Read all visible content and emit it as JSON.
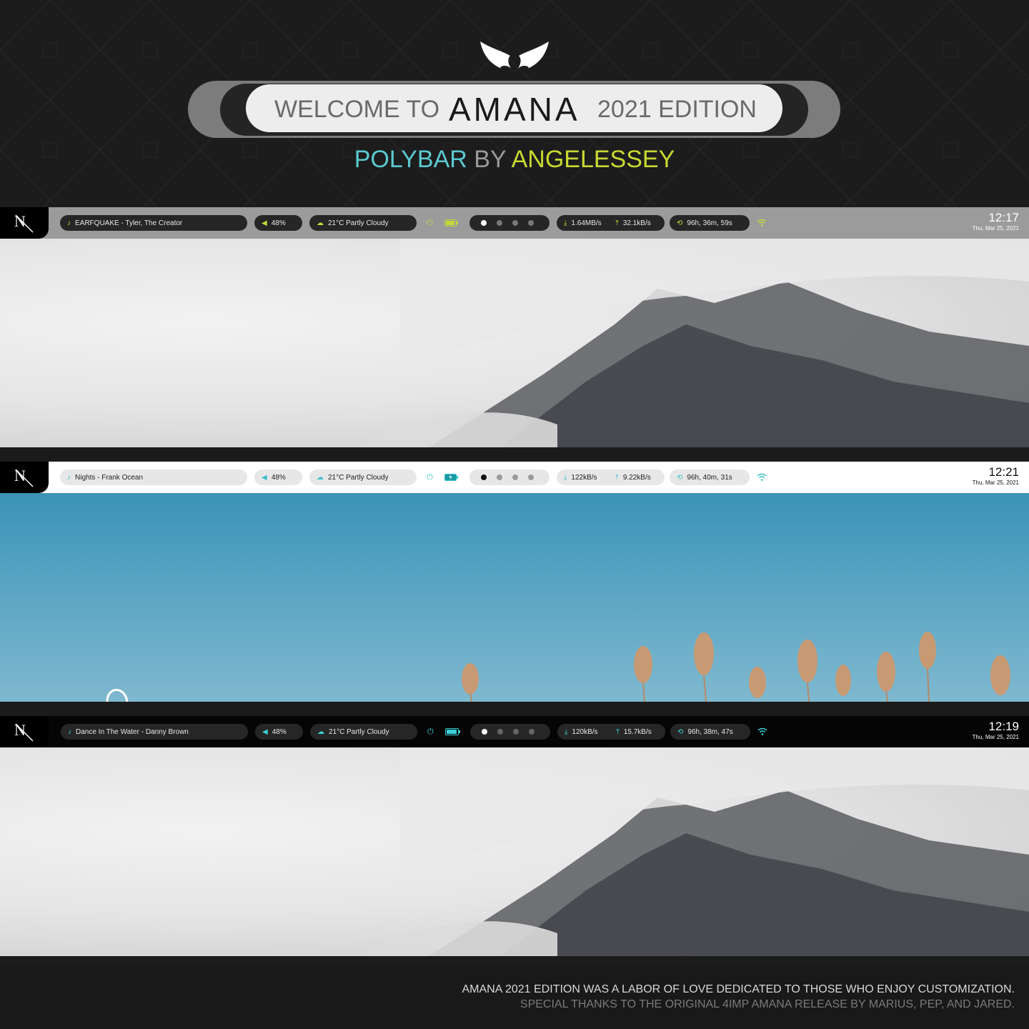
{
  "header": {
    "welcome": "WELCOME TO",
    "name": "AMANA",
    "edition": "2021 EDITION",
    "subtitle_part1": "POLYBAR",
    "subtitle_part2": "BY",
    "subtitle_part3": "ANGELESSEY"
  },
  "bars": [
    {
      "theme": "gray",
      "music": "EARFQUAKE - Tyler, The Creator",
      "volume": "48%",
      "weather": "21°C Partly Cloudy",
      "download": "1.64MB/s",
      "upload": "32.1kB/s",
      "uptime": "96h, 36m, 59s",
      "time": "12:17",
      "date": "Thu, Mar 25, 2021"
    },
    {
      "theme": "white",
      "music": "Nights - Frank Ocean",
      "volume": "48%",
      "weather": "21°C Partly Cloudy",
      "download": "122kB/s",
      "upload": "9.22kB/s",
      "uptime": "96h, 40m, 31s",
      "time": "12:21",
      "date": "Thu, Mar 25, 2021"
    },
    {
      "theme": "black",
      "music": "Dance In The Water - Danny Brown",
      "volume": "48%",
      "weather": "21°C Partly Cloudy",
      "download": "120kB/s",
      "upload": "15.7kB/s",
      "uptime": "96h, 38m, 47s",
      "time": "12:19",
      "date": "Thu, Mar 25, 2021"
    }
  ],
  "icons": {
    "music": "music-note-icon",
    "volume": "speaker-icon",
    "weather": "cloud-icon",
    "power": "power-icon",
    "battery": "battery-icon",
    "download": "download-icon",
    "upload": "upload-icon",
    "uptime": "history-icon",
    "wifi": "wifi-icon"
  },
  "colors": {
    "accent_lime": "#c6d83a",
    "accent_cyan": "#3cbfc7",
    "subtitle_cyan": "#5bc9cf",
    "subtitle_yellow": "#c8d832"
  },
  "footer": {
    "line1": "AMANA 2021 EDITION WAS A LABOR OF LOVE DEDICATED TO THOSE WHO ENJOY CUSTOMIZATION.",
    "line2": "SPECIAL THANKS TO THE ORIGINAL 4IMP AMANA RELEASE BY MARIUS, PEP, AND JARED."
  }
}
